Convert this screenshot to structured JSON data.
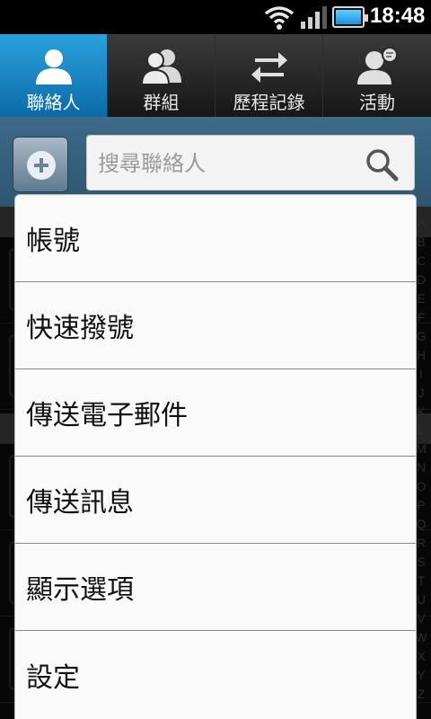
{
  "status_bar": {
    "time": "18:48"
  },
  "tabs": [
    {
      "label": "聯絡人",
      "icon": "person-icon",
      "active": true
    },
    {
      "label": "群組",
      "icon": "group-icon",
      "active": false
    },
    {
      "label": "歷程記錄",
      "icon": "swap-arrows-icon",
      "active": false
    },
    {
      "label": "活動",
      "icon": "person-chat-icon",
      "active": false
    }
  ],
  "search": {
    "placeholder": "搜尋聯絡人"
  },
  "menu": {
    "items": [
      {
        "label": "帳號"
      },
      {
        "label": "快速撥號"
      },
      {
        "label": "傳送電子郵件"
      },
      {
        "label": "傳送訊息"
      },
      {
        "label": "顯示選項"
      },
      {
        "label": "設定"
      }
    ]
  },
  "index_bar": [
    "A",
    "B",
    "C",
    "D",
    "E",
    "F",
    "G",
    "H",
    "I",
    "J",
    "K",
    "L",
    "M",
    "N",
    "O",
    "P",
    "Q",
    "R",
    "S",
    "T",
    "U",
    "V",
    "W",
    "X",
    "Y",
    "Z"
  ],
  "colors": {
    "active_tab": "#1a86c8",
    "toolbar": "#35607c",
    "menu_bg": "#fafafa"
  }
}
